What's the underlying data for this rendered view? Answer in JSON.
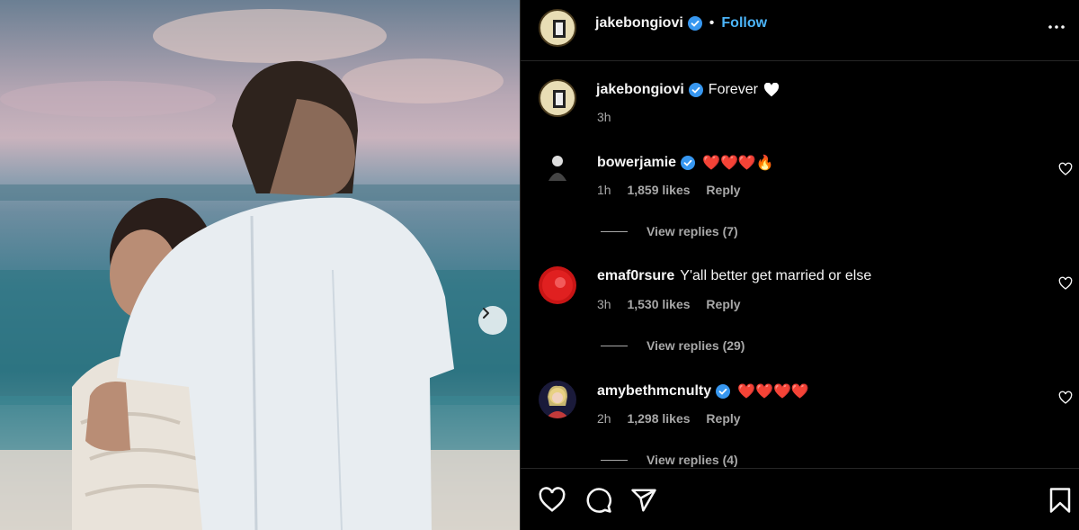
{
  "post": {
    "author": "jakebongiovi",
    "follow_label": "Follow",
    "caption": "Forever",
    "caption_emoji": "♡",
    "caption_time": "3h"
  },
  "comments": [
    {
      "username": "bowerjamie",
      "verified": true,
      "text": "❤️❤️❤️🔥",
      "time": "1h",
      "likes": "1,859 likes",
      "reply_label": "Reply",
      "view_replies": "View replies (7)"
    },
    {
      "username": "emaf0rsure",
      "verified": false,
      "text": "Y'all better get married or else",
      "time": "3h",
      "likes": "1,530 likes",
      "reply_label": "Reply",
      "view_replies": "View replies (29)"
    },
    {
      "username": "amybethmcnulty",
      "verified": true,
      "text": "❤️❤️❤️❤️",
      "time": "2h",
      "likes": "1,298 likes",
      "reply_label": "Reply",
      "view_replies": "View replies (4)"
    }
  ],
  "icons": {
    "like": "heart-icon",
    "comment": "comment-icon",
    "share": "share-icon",
    "save": "bookmark-icon",
    "next": "chevron-right-icon",
    "more": "more-options-icon",
    "verified": "verified-badge-icon"
  },
  "colors": {
    "background": "#000000",
    "follow": "#4cb5f9",
    "verified": "#3797f0",
    "secondary_text": "#a8a8a8",
    "divider": "#262626"
  }
}
